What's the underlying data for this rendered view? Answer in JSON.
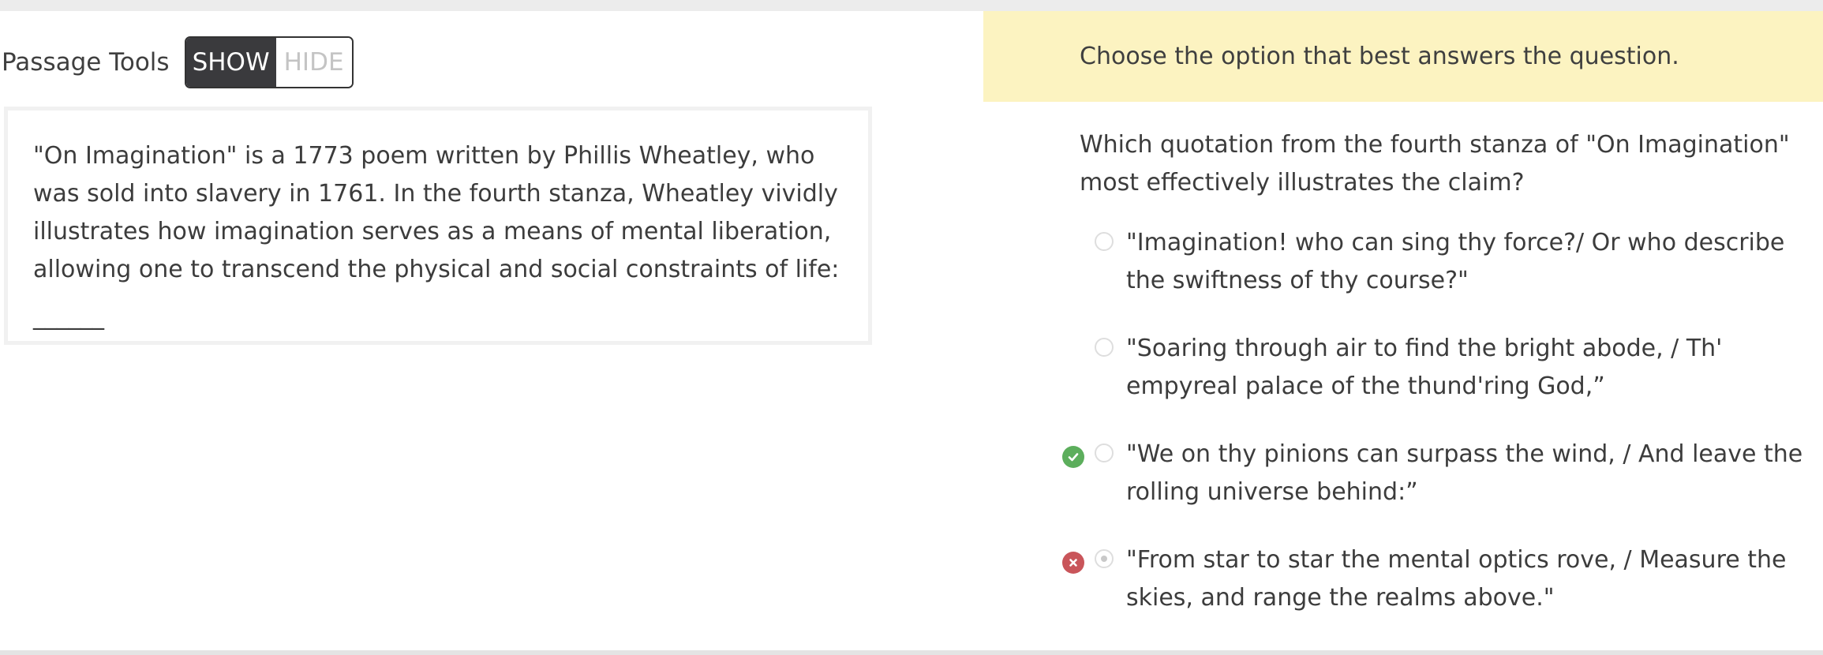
{
  "passage_tools": {
    "label": "Passage Tools",
    "show_label": "SHOW",
    "hide_label": "HIDE",
    "selected": "SHOW"
  },
  "passage": {
    "text": "\"On Imagination\" is a 1773 poem written by Phillis Wheatley, who was sold into slavery in 1761. In the fourth stanza, Wheatley vividly illustrates how imagination serves as a means of mental liberation, allowing one to transcend the physical and social constraints of life:",
    "blank": "______"
  },
  "instruction": "Choose the option that best answers the question.",
  "question": "Which quotation from the fourth stanza of \"On Imagination\" most effectively illustrates the claim?",
  "options": [
    {
      "text": "\"Imagination! who can sing thy force?/ Or who describe the swiftness of thy course?\"",
      "status": "none",
      "selected": false
    },
    {
      "text": "\"Soaring through air to find the bright abode, / Th' empyreal palace of the thund'ring God,”",
      "status": "none",
      "selected": false
    },
    {
      "text": "\"We on thy pinions can surpass the wind, / And leave the rolling universe behind:”",
      "status": "correct",
      "selected": false
    },
    {
      "text": "\"From star to star the mental optics rove, / Measure the skies, and range the realms above.\"",
      "status": "incorrect",
      "selected": true
    }
  ],
  "colors": {
    "instruction_bg": "#fcf3c1",
    "toggle_on_bg": "#3a3a3d",
    "correct": "#5cae5c",
    "incorrect": "#c9555a"
  }
}
